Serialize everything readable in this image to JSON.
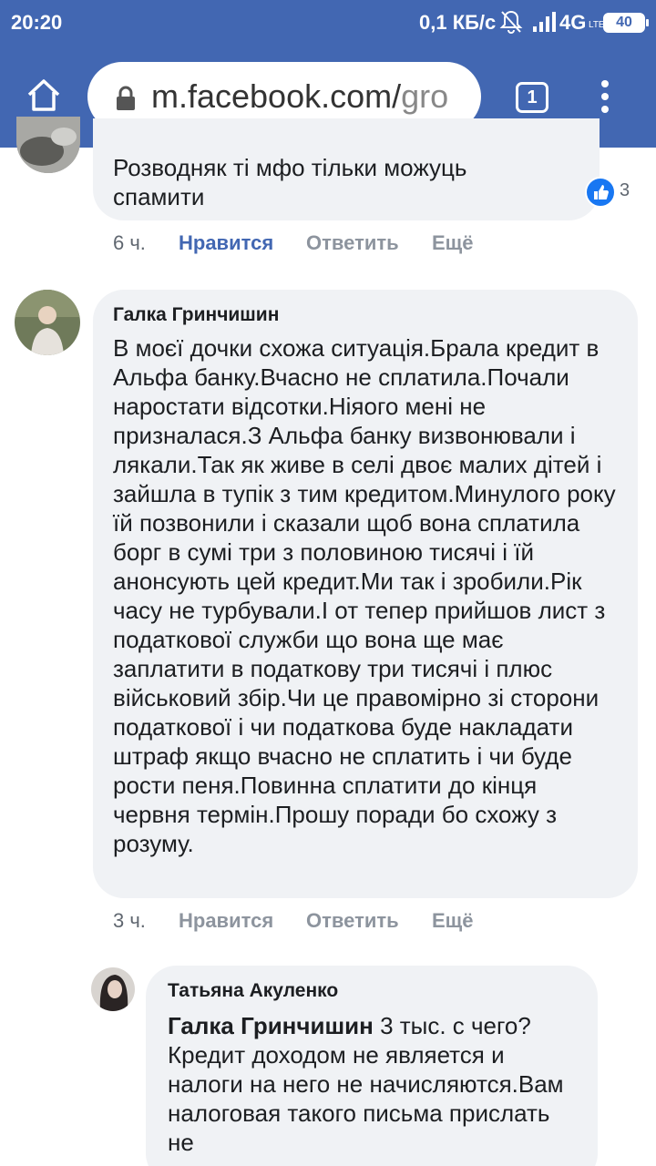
{
  "status": {
    "time": "20:20",
    "speed": "0,1 КБ/с",
    "network": "4G",
    "lte_mark": "LTE",
    "battery": "40"
  },
  "browser": {
    "url_main": "m.facebook.com/",
    "url_dim": "gro",
    "tab_count": "1"
  },
  "comments": [
    {
      "text": "Розводняк ті мфо тільки можуць спамити",
      "reaction_count": "3",
      "time": "6 ч.",
      "like": "Нравится",
      "reply": "Ответить",
      "more": "Ещё"
    },
    {
      "author": "Галка Гринчишин",
      "text": "В моєї дочки схожа ситуація.Брала кредит в Альфа банку.Вчасно не сплатила.Почали наростати відсотки.Ніяого мені не призналася.З Альфа банку визвонювали і лякали.Так як живе в селі двоє малих дітей і зайшла в тупік з тим кредитом.Минулого року їй позвонили і сказали щоб вона сплатила борг в сумі три з половиною тисячі і їй анонсують цей кредит.Ми так і зробили.Рік часу не турбували.І от тепер прийшов лист з податкової служби що вона ще має заплатити в податкову три тисячі і плюс військовий збір.Чи це правомірно зі сторони податкової і чи податкова буде накладати штраф якщо вчасно не сплатить і чи буде рости пеня.Повинна сплатити до кінця червня термін.Прошу поради бо схожу з розуму.",
      "time": "3 ч.",
      "like": "Нравится",
      "reply": "Ответить",
      "more": "Ещё"
    },
    {
      "author": "Татьяна Акуленко",
      "mention": "Галка Гринчишин",
      "text": "3 тыс. с чего? Кредит доходом не является и налоги на него не начисляются.Вам налоговая такого письма прислать не"
    }
  ]
}
